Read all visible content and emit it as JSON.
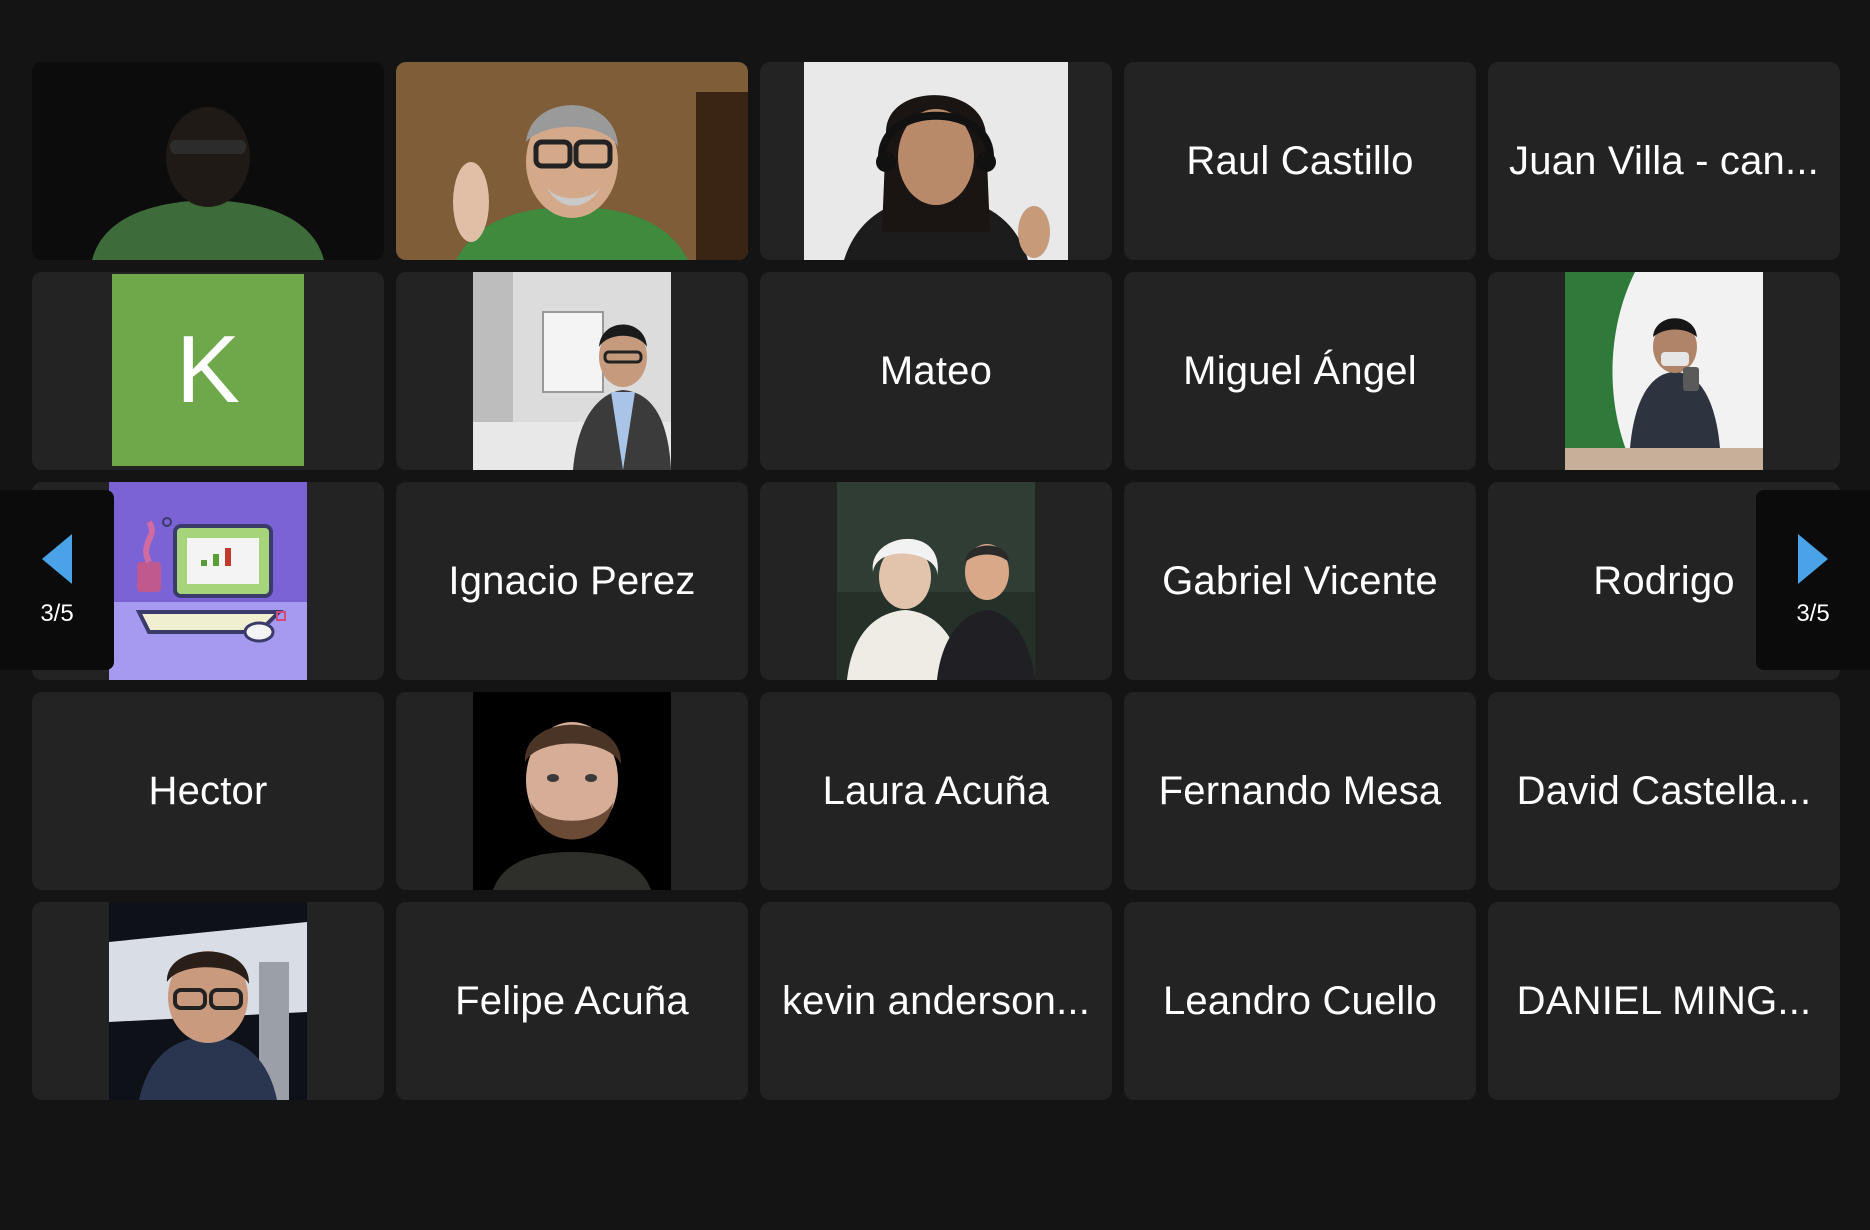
{
  "pagination": {
    "prev_label": "3/5",
    "next_label": "3/5"
  },
  "participants": [
    {
      "kind": "video",
      "scene": "dark-man-green-shirt"
    },
    {
      "kind": "video",
      "scene": "man-glasses-thumbs-up"
    },
    {
      "kind": "video",
      "scene": "woman-headset-thumbs-up"
    },
    {
      "kind": "name",
      "name": "Raul Castillo"
    },
    {
      "kind": "name",
      "name": "Juan Villa - can..."
    },
    {
      "kind": "avatar",
      "initial": "K",
      "color": "#6fa84a"
    },
    {
      "kind": "photo",
      "scene": "man-in-suit-office"
    },
    {
      "kind": "name",
      "name": "Mateo"
    },
    {
      "kind": "name",
      "name": "Miguel Ángel"
    },
    {
      "kind": "photo",
      "scene": "mirror-selfie-green-wall"
    },
    {
      "kind": "photo",
      "scene": "laptop-illustration"
    },
    {
      "kind": "name",
      "name": "Ignacio Perez"
    },
    {
      "kind": "photo",
      "scene": "man-with-einstein-statue"
    },
    {
      "kind": "name",
      "name": "Gabriel Vicente"
    },
    {
      "kind": "name",
      "name": "Rodrigo"
    },
    {
      "kind": "name",
      "name": "Hector"
    },
    {
      "kind": "photo",
      "scene": "bearded-man-black-bg"
    },
    {
      "kind": "name",
      "name": "Laura Acuña"
    },
    {
      "kind": "name",
      "name": "Fernando Mesa"
    },
    {
      "kind": "name",
      "name": "David Castella..."
    },
    {
      "kind": "photo",
      "scene": "man-glasses-airport-night"
    },
    {
      "kind": "name",
      "name": "Felipe Acuña"
    },
    {
      "kind": "name",
      "name": "kevin anderson..."
    },
    {
      "kind": "name",
      "name": "Leandro Cuello"
    },
    {
      "kind": "name",
      "name": "DANIEL MING..."
    }
  ],
  "colors": {
    "background": "#141414",
    "tile": "#232323",
    "pager": "#0b0b0b",
    "arrow": "#4aa3e6",
    "avatar_green": "#6fa84a"
  }
}
